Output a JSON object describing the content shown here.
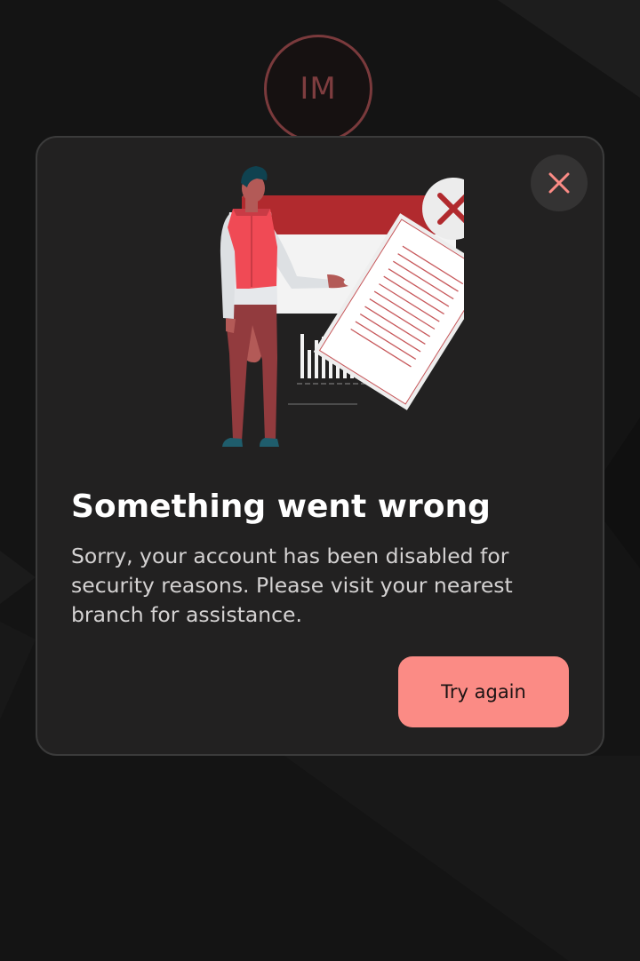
{
  "avatar": {
    "initials": "IM"
  },
  "dialog": {
    "title": "Something went wrong",
    "message": "Sorry, your account has been disabled for security reasons. Please visit your nearest branch for assistance.",
    "primary_action": "Try again",
    "close_icon": "close-icon"
  },
  "colors": {
    "background": "#141414",
    "dialog_surface": "#222121",
    "accent": "#fb8b85",
    "error_red": "#b12a2e"
  }
}
